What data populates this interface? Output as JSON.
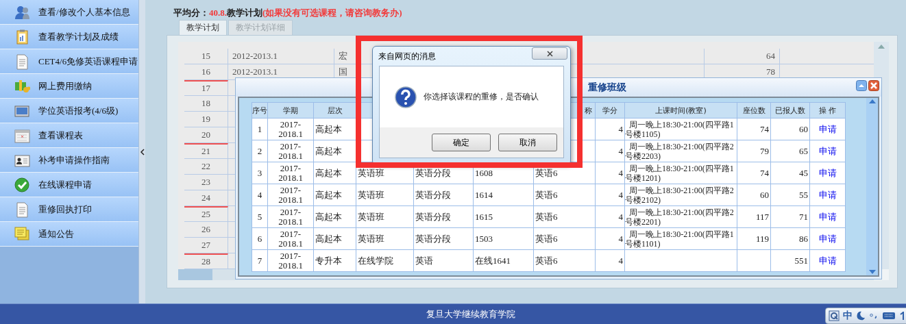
{
  "sidebar": {
    "items": [
      {
        "label": "查看/修改个人基本信息"
      },
      {
        "label": "查看教学计划及成绩"
      },
      {
        "label": "CET4/6免修英语课程申请"
      },
      {
        "label": "网上费用缴纳"
      },
      {
        "label": "学位英语报考(4/6级)"
      },
      {
        "label": "查看课程表"
      },
      {
        "label": "补考申请操作指南"
      },
      {
        "label": "在线课程申请"
      },
      {
        "label": "重修回执打印"
      },
      {
        "label": "通知公告"
      }
    ]
  },
  "heading": {
    "label": "平均分：",
    "score": "40.8.",
    "title": "教学计划",
    "note": "(如果没有可选课程，请咨询教务办)"
  },
  "tabs": [
    {
      "label": "教学计划",
      "selected": true
    },
    {
      "label": "教学计划详细",
      "selected": false
    }
  ],
  "plan_table": {
    "rows": [
      {
        "no": "15",
        "term": "2012-2013.1",
        "course": "宏",
        "score": "64",
        "red_rule_above": false
      },
      {
        "no": "16",
        "term": "2012-2013.1",
        "course": "国",
        "score": "78",
        "red_rule_above": false
      },
      {
        "no": "17",
        "red_rule_above": true
      },
      {
        "no": "18",
        "red_rule_above": false
      },
      {
        "no": "19",
        "red_rule_above": false
      },
      {
        "no": "20",
        "red_rule_above": false
      },
      {
        "no": "21",
        "red_rule_above": true
      },
      {
        "no": "22",
        "red_rule_above": false
      },
      {
        "no": "23",
        "red_rule_above": false
      },
      {
        "no": "24",
        "red_rule_above": false
      },
      {
        "no": "25",
        "red_rule_above": true
      },
      {
        "no": "26",
        "red_rule_above": false
      },
      {
        "no": "27",
        "red_rule_above": false
      },
      {
        "no": "28",
        "red_rule_above": true
      }
    ]
  },
  "class_window": {
    "title": "重修班级",
    "header": {
      "no": "序号",
      "term": "学期",
      "level": "层次",
      "course_name": "称",
      "credit": "学分",
      "time": "上课时间(教室)",
      "seats": "座位数",
      "enrolled": "已报人数",
      "action": "操 作"
    },
    "rows": [
      {
        "no": "1",
        "term": "2017-2018.1",
        "level": "高起本",
        "credit": "4",
        "time": "周一晚上18:30-21:00(四平路1号楼1105)",
        "seats": "74",
        "enrolled": "60",
        "action": "申请"
      },
      {
        "no": "2",
        "term": "2017-2018.1",
        "level": "高起本",
        "credit": "4",
        "time": "周一晚上18:30-21:00(四平路2号楼2203)",
        "seats": "79",
        "enrolled": "65",
        "action": "申请"
      },
      {
        "no": "3",
        "term": "2017-2018.1",
        "level": "高起本",
        "class_type": "英语班",
        "course": "英语分段",
        "class_no": "1608",
        "course_name": "英语6",
        "credit": "4",
        "time": "周一晚上18:30-21:00(四平路1号楼1201)",
        "seats": "74",
        "enrolled": "45",
        "action": "申请"
      },
      {
        "no": "4",
        "term": "2017-2018.1",
        "level": "高起本",
        "class_type": "英语班",
        "course": "英语分段",
        "class_no": "1614",
        "course_name": "英语6",
        "credit": "4",
        "time": "周一晚上18:30-21:00(四平路2号楼2102)",
        "seats": "60",
        "enrolled": "55",
        "action": "申请"
      },
      {
        "no": "5",
        "term": "2017-2018.1",
        "level": "高起本",
        "class_type": "英语班",
        "course": "英语分段",
        "class_no": "1615",
        "course_name": "英语6",
        "credit": "4",
        "time": "周一晚上18:30-21:00(四平路2号楼2201)",
        "seats": "117",
        "enrolled": "71",
        "action": "申请"
      },
      {
        "no": "6",
        "term": "2017-2018.1",
        "level": "高起本",
        "class_type": "英语班",
        "course": "英语分段",
        "class_no": "1503",
        "course_name": "英语6",
        "credit": "4",
        "time": "周一晚上18:30-21:00(四平路1号楼1101)",
        "seats": "119",
        "enrolled": "86",
        "action": "申请"
      },
      {
        "no": "7",
        "term": "2017-2018.1",
        "level": "专升本",
        "class_type": "在线学院",
        "course": "英语",
        "class_no": "在线1641",
        "course_name": "英语6",
        "credit": "4",
        "enrolled": "551",
        "action": "申请"
      }
    ]
  },
  "message_box": {
    "title": "来自网页的消息",
    "message": "你选择该课程的重修，是否确认",
    "buttons": [
      "确定",
      "取消"
    ]
  },
  "footer": {
    "text": "复旦大学继续教育学院"
  },
  "ime": {
    "mode": "中"
  }
}
